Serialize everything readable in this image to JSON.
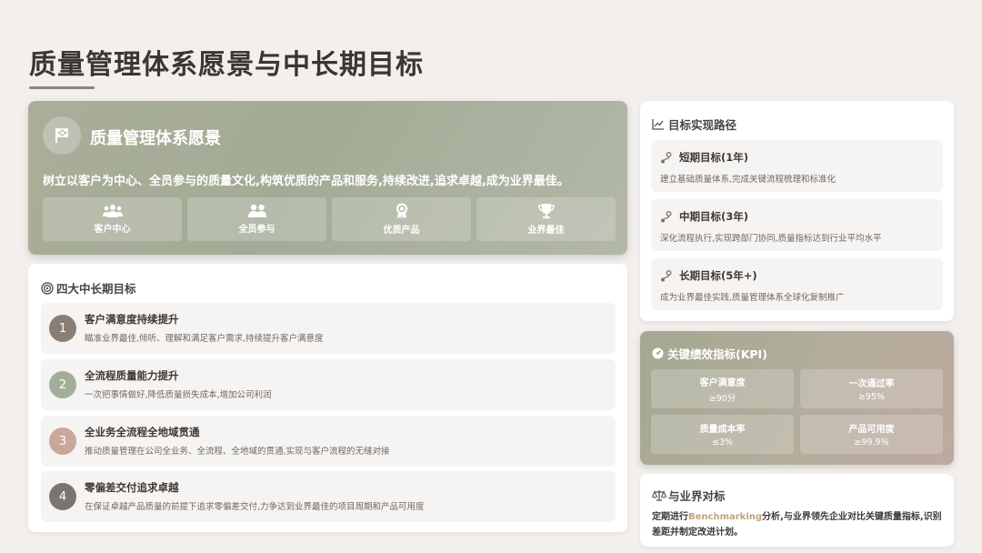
{
  "page": {
    "title": "质量管理体系愿景与中长期目标"
  },
  "vision": {
    "icon": "flag-icon",
    "title": "质量管理体系愿景",
    "description": "树立以客户为中心、全员参与的质量文化,构筑优质的产品和服务,持续改进,追求卓越,成为业界最佳。",
    "values": [
      {
        "icon": "users-icon",
        "label": "客户中心"
      },
      {
        "icon": "team-icon",
        "label": "全员参与"
      },
      {
        "icon": "award-icon",
        "label": "优质产品"
      },
      {
        "icon": "trophy-icon",
        "label": "业界最佳"
      }
    ]
  },
  "goals": {
    "header": "四大中长期目标",
    "header_icon": "target-icon",
    "items": [
      {
        "num": "1",
        "title": "客户满意度持续提升",
        "desc": "瞄准业界最佳,倾听、理解和满足客户需求,持续提升客户满意度",
        "color": "#8a7e74"
      },
      {
        "num": "2",
        "title": "全流程质量能力提升",
        "desc": "一次把事情做好,降低质量损失成本,增加公司利润",
        "color": "#a3ae9a"
      },
      {
        "num": "3",
        "title": "全业务全流程全地域贯通",
        "desc": "推动质量管理在公司全业务、全流程、全地域的贯通,实现与客户流程的无缝对接",
        "color": "#c9a79a"
      },
      {
        "num": "4",
        "title": "零偏差交付追求卓越",
        "desc": "在保证卓越产品质量的前提下追求零偏差交付,力争达到业界最佳的项目周期和产品可用度",
        "color": "#7d746d"
      }
    ]
  },
  "path": {
    "header": "目标实现路径",
    "header_icon": "line-chart-icon",
    "items": [
      {
        "icon": "route-icon",
        "title": "短期目标(1年)",
        "desc": "建立基础质量体系,完成关键流程梳理和标准化"
      },
      {
        "icon": "route-icon",
        "title": "中期目标(3年)",
        "desc": "深化流程执行,实现跨部门协同,质量指标达到行业平均水平"
      },
      {
        "icon": "route-icon",
        "title": "长期目标(5年+)",
        "desc": "成为业界最佳实践,质量管理体系全球化复制推广"
      }
    ]
  },
  "kpi": {
    "header": "关键绩效指标(KPI)",
    "header_icon": "gauge-icon",
    "items": [
      {
        "name": "客户满意度",
        "target": "≥90分"
      },
      {
        "name": "一次通过率",
        "target": "≥95%"
      },
      {
        "name": "质量成本率",
        "target": "≤3%"
      },
      {
        "name": "产品可用度",
        "target": "≥99.9%"
      }
    ]
  },
  "benchmark": {
    "header": "与业界对标",
    "header_icon": "scale-icon",
    "text_before": "定期进行",
    "highlight": "Benchmarking",
    "text_after": "分析,与业界领先企业对比关键质量指标,识别差距并制定改进计划。"
  }
}
